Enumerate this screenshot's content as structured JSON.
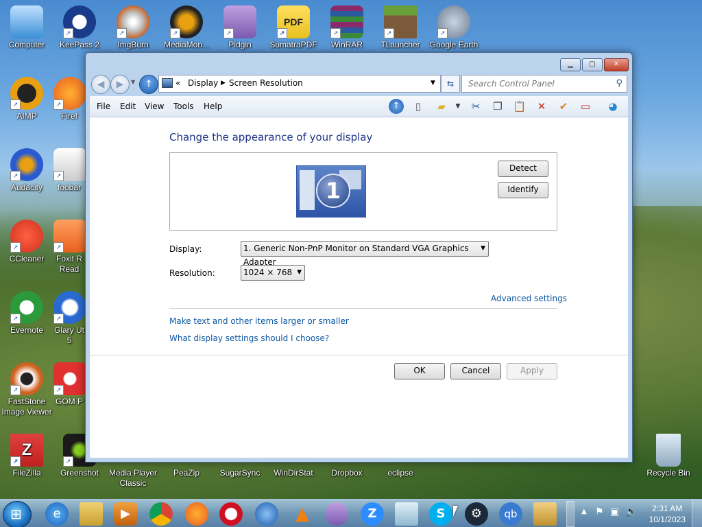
{
  "desktop": {
    "icons": [
      {
        "label": "Computer",
        "color": "#3a8fd6"
      },
      {
        "label": "KeePass 2",
        "color": "#1a3a8a"
      },
      {
        "label": "ImgBurn",
        "color": "#c8662a"
      },
      {
        "label": "MediaMon...",
        "color": "#222222"
      },
      {
        "label": "Pidgin",
        "color": "#7a5ab0"
      },
      {
        "label": "SumatraPDF",
        "color": "#e8c020"
      },
      {
        "label": "WinRAR",
        "color": "#8a2a6a"
      },
      {
        "label": "TLauncher",
        "color": "#4a8a2a"
      },
      {
        "label": "Google Earth",
        "color": "#8a9ab0"
      },
      {
        "label": "AIMP",
        "color": "#e8a010"
      },
      {
        "label": "Firef",
        "color": "#e85a20"
      },
      {
        "label": "Audacity",
        "color": "#2a5ad0"
      },
      {
        "label": "foobar",
        "color": "#ffffff"
      },
      {
        "label": "CCleaner",
        "color": "#d03020"
      },
      {
        "label": "Foxit R",
        "color": "#e86020"
      },
      {
        "label": "Read",
        "color": "#e86020"
      },
      {
        "label": "Evernote",
        "color": "#2a9a3a"
      },
      {
        "label": "Glary Ut",
        "color": "#2a6ad0"
      },
      {
        "label": "5",
        "color": "#2a6ad0"
      },
      {
        "label": "FastStone",
        "color": "#d06020"
      },
      {
        "label": "Image Viewer",
        "color": "#d06020"
      },
      {
        "label": "GOM P",
        "color": "#e03030"
      },
      {
        "label": "FileZilla",
        "color": "#c02020"
      },
      {
        "label": "Greenshot",
        "color": "#1a1a1a"
      },
      {
        "label": "Media Player",
        "color": "#3a3a3a"
      },
      {
        "label": "Classic",
        "color": "#3a3a3a"
      },
      {
        "label": "PeaZip",
        "color": "#3a8a3a"
      },
      {
        "label": "SugarSync",
        "color": "#2a6ad0"
      },
      {
        "label": "WinDirStat",
        "color": "#2a6ad0"
      },
      {
        "label": "Dropbox",
        "color": "#1a5ae0"
      },
      {
        "label": "eclipse",
        "color": "#3a3a8a"
      },
      {
        "label": "Recycle Bin",
        "color": "#a0b8d0"
      }
    ]
  },
  "window": {
    "breadcrumb": [
      "«",
      "Display",
      "Screen Resolution"
    ],
    "search_placeholder": "Search Control Panel",
    "menu": [
      "File",
      "Edit",
      "View",
      "Tools",
      "Help"
    ],
    "heading": "Change the appearance of your display",
    "monitor_number": "1",
    "detect_label": "Detect",
    "identify_label": "Identify",
    "display_label": "Display:",
    "display_value": "1. Generic Non-PnP Monitor on Standard VGA Graphics Adapter",
    "resolution_label": "Resolution:",
    "resolution_value": "1024 × 768",
    "advanced_link": "Advanced settings",
    "link_text_size": "Make text and other items larger or smaller",
    "link_display_help": "What display settings should I choose?",
    "ok_label": "OK",
    "cancel_label": "Cancel",
    "apply_label": "Apply"
  },
  "taskbar": {
    "clock_time": "2:31 AM",
    "clock_date": "10/1/2023",
    "pinned_icon_names": [
      "ie-icon",
      "explorer-icon",
      "media-icon",
      "chrome-icon",
      "firefox-icon",
      "opera-icon",
      "thunderbird-icon",
      "vlc-icon",
      "pidgin-icon",
      "zoom-icon",
      "notepad-icon",
      "skype-icon",
      "steam-icon",
      "qbittorrent-icon",
      "paint-icon"
    ]
  }
}
